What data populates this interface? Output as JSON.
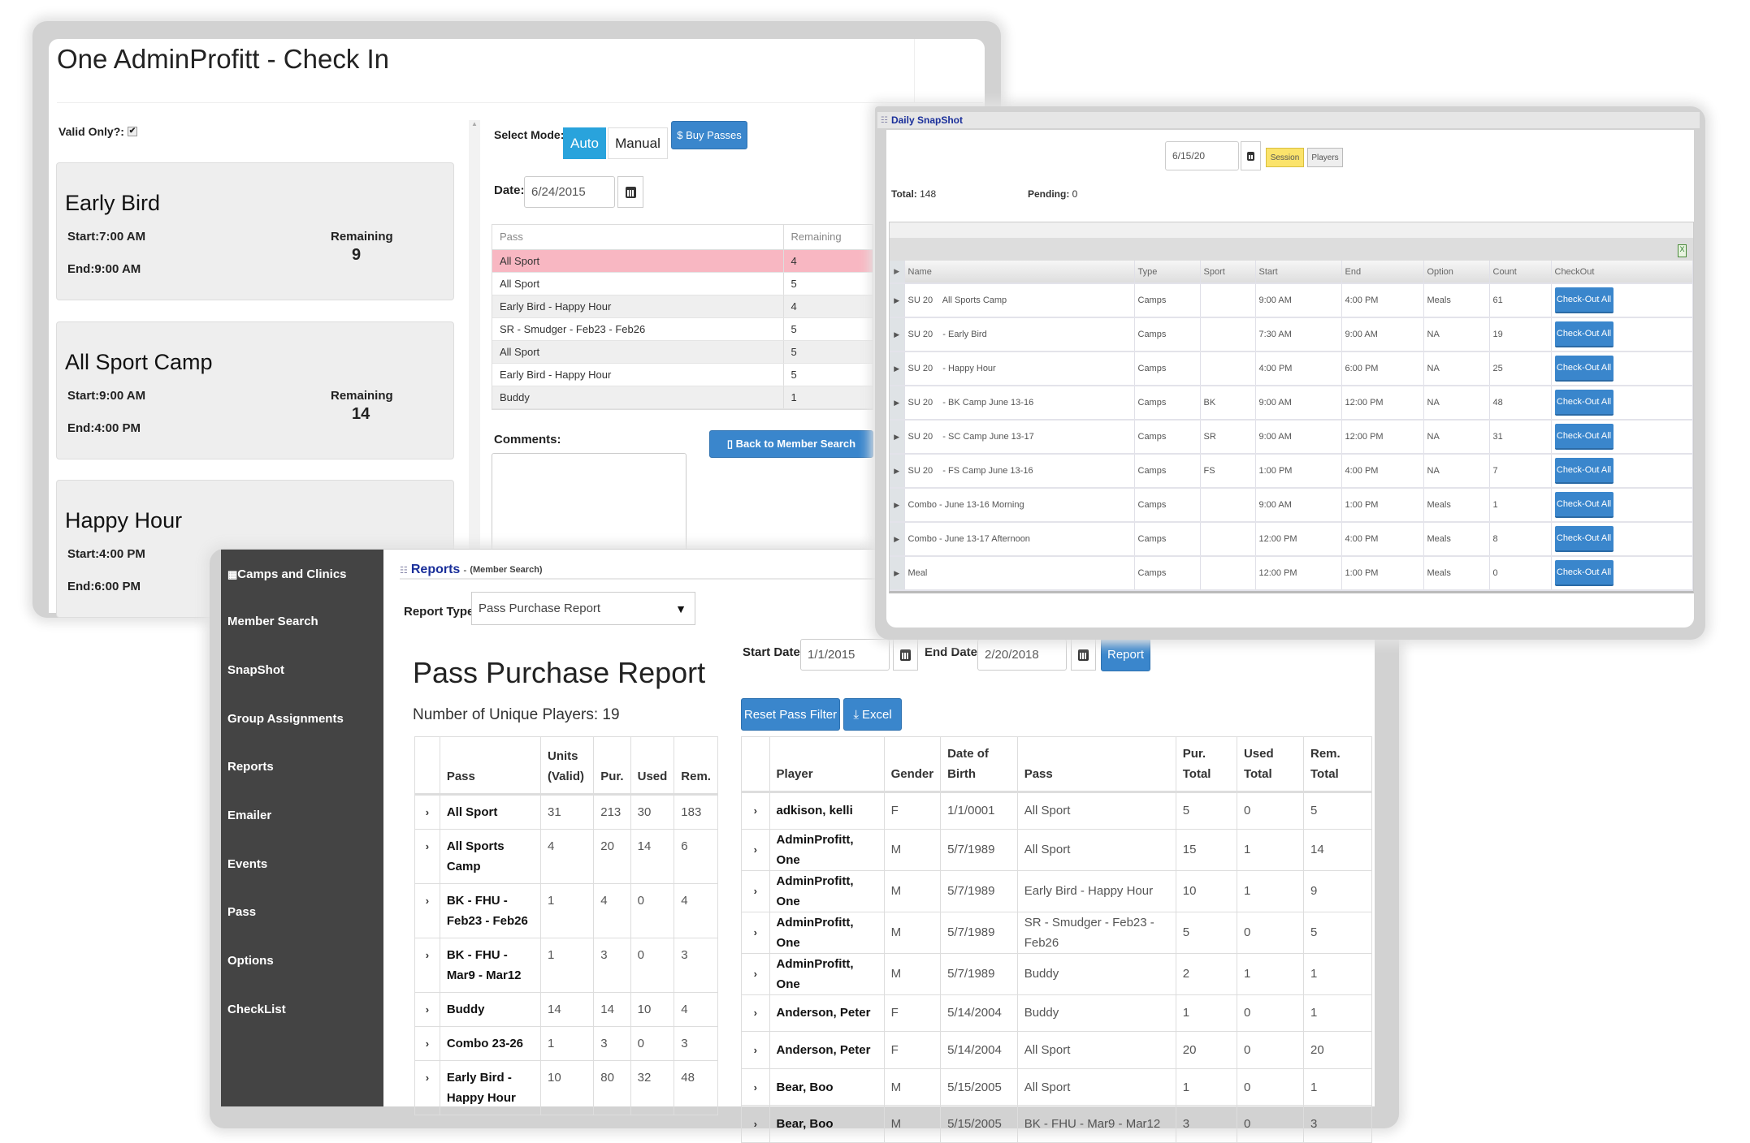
{
  "checkin": {
    "title": "One AdminProfitt - Check In",
    "valid_only_label": "Valid Only?:",
    "valid_only_checked": true,
    "cards": [
      {
        "name": "Early Bird",
        "start": "Start:7:00 AM",
        "end": "End:9:00 AM",
        "remaining_label": "Remaining",
        "remaining": "9"
      },
      {
        "name": "All Sport Camp",
        "start": "Start:9:00 AM",
        "end": "End:4:00 PM",
        "remaining_label": "Remaining",
        "remaining": "14"
      },
      {
        "name": "Happy Hour",
        "start": "Start:4:00 PM",
        "end": "End:6:00 PM",
        "remaining_label": "Remaining",
        "remaining": ""
      }
    ],
    "select_mode_label": "Select Mode:",
    "mode_auto": "Auto",
    "mode_manual": "Manual",
    "buy_passes": "$ Buy Passes",
    "date_label": "Date:",
    "date_value": "6/24/2015",
    "pass_table": {
      "headers": [
        "Pass",
        "Remaining"
      ],
      "rows": [
        [
          "All Sport",
          "4"
        ],
        [
          "All Sport",
          "5"
        ],
        [
          "Early Bird - Happy Hour",
          "4"
        ],
        [
          "SR - Smudger - Feb23 - Feb26",
          "5"
        ],
        [
          "All Sport",
          "5"
        ],
        [
          "Early Bird - Happy Hour",
          "5"
        ],
        [
          "Buddy",
          "1"
        ]
      ]
    },
    "comments_label": "Comments:",
    "back_button": "▯ Back to Member Search",
    "highlight_color": "#f8b7c2"
  },
  "snapshot": {
    "title": "Daily SnapShot",
    "date_value": "6/15/20",
    "session_button": "Session",
    "players_button": "Players",
    "total_label": "Total:",
    "total": "148",
    "pending_label": "Pending:",
    "pending": "0",
    "headers": [
      "Name",
      "Type",
      "Sport",
      "Start",
      "End",
      "Option",
      "Count",
      "CheckOut"
    ],
    "rows": [
      [
        "SU 20    All Sports Camp",
        "Camps",
        "",
        "9:00 AM",
        "4:00 PM",
        "Meals",
        "61"
      ],
      [
        "SU 20    - Early Bird",
        "Camps",
        "",
        "7:30 AM",
        "9:00 AM",
        "NA",
        "19"
      ],
      [
        "SU 20    - Happy Hour",
        "Camps",
        "",
        "4:00 PM",
        "6:00 PM",
        "NA",
        "25"
      ],
      [
        "SU 20    - BK Camp June 13-16",
        "Camps",
        "BK",
        "9:00 AM",
        "12:00 PM",
        "NA",
        "48"
      ],
      [
        "SU 20    - SC Camp June 13-17",
        "Camps",
        "SR",
        "9:00 AM",
        "12:00 PM",
        "NA",
        "31"
      ],
      [
        "SU 20    - FS Camp June 13-16",
        "Camps",
        "FS",
        "1:00 PM",
        "4:00 PM",
        "NA",
        "7"
      ],
      [
        "Combo - June 13-16 Morning",
        "Camps",
        "",
        "9:00 AM",
        "1:00 PM",
        "Meals",
        "1"
      ],
      [
        "Combo - June 13-17 Afternoon",
        "Camps",
        "",
        "12:00 PM",
        "4:00 PM",
        "Meals",
        "8"
      ],
      [
        "Meal",
        "Camps",
        "",
        "12:00 PM",
        "1:00 PM",
        "Meals",
        "0"
      ]
    ],
    "checkout_button": "Check-Out All",
    "session_color": "#fbe36b"
  },
  "reports": {
    "sidebar": [
      "Camps and Clinics",
      "Member Search",
      "SnapShot",
      "Group Assignments",
      "Reports",
      "Emailer",
      "Events",
      "Pass",
      "Options",
      "CheckList"
    ],
    "breadcrumb_main": "Reports",
    "breadcrumb_sub": "(Member Search)",
    "report_type_label": "Report Type:",
    "report_type_value": "Pass Purchase Report",
    "heading": "Pass Purchase Report",
    "unique_players": "Number of Unique Players: 19",
    "start_date_label": "Start Date:",
    "start_date": "1/1/2015",
    "end_date_label": "End Date:",
    "end_date": "2/20/2018",
    "report_button": "Report",
    "reset_button": "Reset Pass Filter",
    "excel_button": "Excel",
    "summary": {
      "headers": [
        "Pass",
        "Units (Valid)",
        "Pur.",
        "Used",
        "Rem."
      ],
      "rows": [
        [
          "All Sport",
          "31",
          "213",
          "30",
          "183"
        ],
        [
          "All Sports Camp",
          "4",
          "20",
          "14",
          "6"
        ],
        [
          "BK - FHU - Feb23 - Feb26",
          "1",
          "4",
          "0",
          "4"
        ],
        [
          "BK - FHU - Mar9 - Mar12",
          "1",
          "3",
          "0",
          "3"
        ],
        [
          "Buddy",
          "14",
          "14",
          "10",
          "4"
        ],
        [
          "Combo 23-26",
          "1",
          "3",
          "0",
          "3"
        ],
        [
          "Early Bird - Happy Hour",
          "10",
          "80",
          "32",
          "48"
        ]
      ]
    },
    "players": {
      "headers": [
        "Player",
        "Gender",
        "Date of Birth",
        "Pass",
        "Pur. Total",
        "Used Total",
        "Rem. Total"
      ],
      "rows": [
        [
          "adkison, kelli",
          "F",
          "1/1/0001",
          "All Sport",
          "5",
          "0",
          "5"
        ],
        [
          "AdminProfitt, One",
          "M",
          "5/7/1989",
          "All Sport",
          "15",
          "1",
          "14"
        ],
        [
          "AdminProfitt, One",
          "M",
          "5/7/1989",
          "Early Bird - Happy Hour",
          "10",
          "1",
          "9"
        ],
        [
          "AdminProfitt, One",
          "M",
          "5/7/1989",
          "SR - Smudger - Feb23 - Feb26",
          "5",
          "0",
          "5"
        ],
        [
          "AdminProfitt, One",
          "M",
          "5/7/1989",
          "Buddy",
          "2",
          "1",
          "1"
        ],
        [
          "Anderson, Peter",
          "F",
          "5/14/2004",
          "Buddy",
          "1",
          "0",
          "1"
        ],
        [
          "Anderson, Peter",
          "F",
          "5/14/2004",
          "All Sport",
          "20",
          "0",
          "20"
        ],
        [
          "Bear, Boo",
          "M",
          "5/15/2005",
          "All Sport",
          "1",
          "0",
          "1"
        ],
        [
          "Bear, Boo",
          "M",
          "5/15/2005",
          "BK - FHU - Mar9 - Mar12",
          "3",
          "0",
          "3"
        ]
      ]
    },
    "accent_color": "#3a86cc",
    "sidebar_color": "#444444"
  }
}
